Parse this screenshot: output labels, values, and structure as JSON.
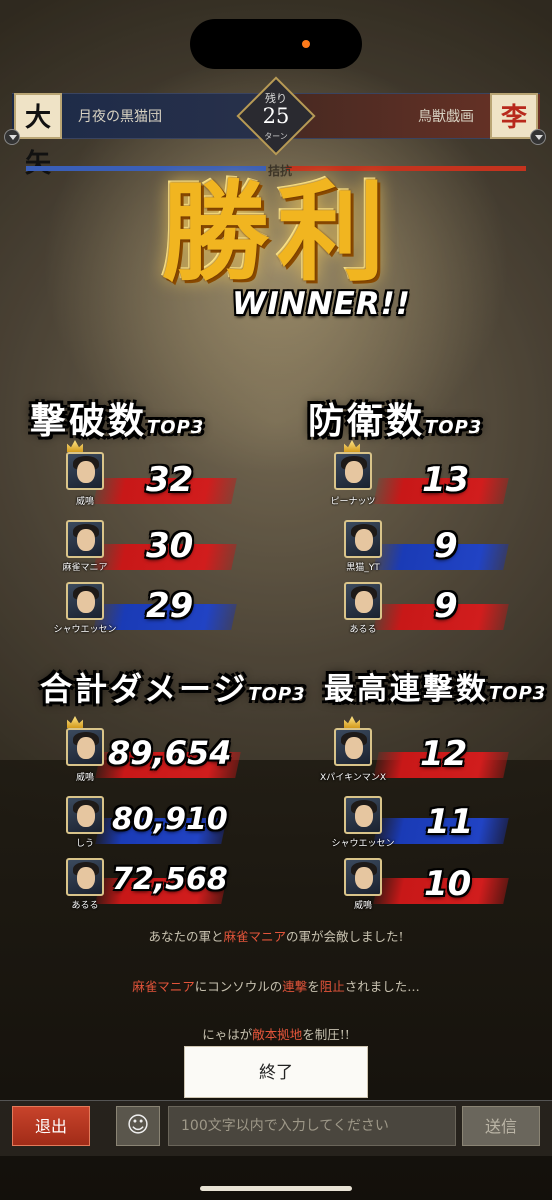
{
  "header": {
    "left_badge": "大矢",
    "right_badge": "李",
    "left_team": "月夜の黒猫団",
    "right_team": "鳥獣戯画",
    "turns_remaining_label": "残り",
    "turns_remaining": "25",
    "turn_unit": "ターン",
    "kikou_label": "拮抗"
  },
  "victory": {
    "title": "勝利",
    "subtitle": "WINNER!!"
  },
  "stats": {
    "kills": {
      "title": "撃破数",
      "suffix": "TOP3",
      "entries": [
        {
          "name": "威鳴",
          "value": "32",
          "color": "red"
        },
        {
          "name": "麻雀マニア",
          "value": "30",
          "color": "red"
        },
        {
          "name": "シャウエッセン",
          "value": "29",
          "color": "blue"
        }
      ]
    },
    "defense": {
      "title": "防衛数",
      "suffix": "TOP3",
      "entries": [
        {
          "name": "ピーナッツ",
          "value": "13",
          "color": "red"
        },
        {
          "name": "黒猫_YT",
          "value": "9",
          "color": "blue"
        },
        {
          "name": "あるる",
          "value": "9",
          "color": "red"
        }
      ]
    },
    "damage": {
      "title": "合計ダメージ",
      "suffix": "TOP3",
      "entries": [
        {
          "name": "威鳴",
          "value": "89,654",
          "color": "red"
        },
        {
          "name": "しう",
          "value": "80,910",
          "color": "blue"
        },
        {
          "name": "あるる",
          "value": "72,568",
          "color": "red"
        }
      ]
    },
    "combo": {
      "title": "最高連撃数",
      "suffix": "TOP3",
      "entries": [
        {
          "name": "XパイキンマンX",
          "value": "12",
          "color": "red"
        },
        {
          "name": "シャウエッセン",
          "value": "11",
          "color": "blue"
        },
        {
          "name": "威鳴",
          "value": "10",
          "color": "red"
        }
      ]
    }
  },
  "messages": [
    {
      "parts": [
        "あなたの軍と",
        "麻雀マニア",
        "の軍が会敵しました!"
      ]
    },
    {
      "parts": [
        "麻雀マニア",
        "にコンソウルの",
        "連撃",
        "を",
        "阻止",
        "されました…"
      ]
    },
    {
      "parts": [
        "にゃはが",
        "敵本拠地",
        "を制圧!!"
      ]
    }
  ],
  "end_button": "終了",
  "bottom": {
    "exit": "退出",
    "emoji": "☺",
    "chat_placeholder": "100文字以内で入力してください",
    "send": "送信"
  },
  "colors": {
    "red_brush": "#c81818",
    "blue_brush": "#1a3bb6",
    "gold": "#f1b520",
    "highlight": "#e2543a"
  }
}
